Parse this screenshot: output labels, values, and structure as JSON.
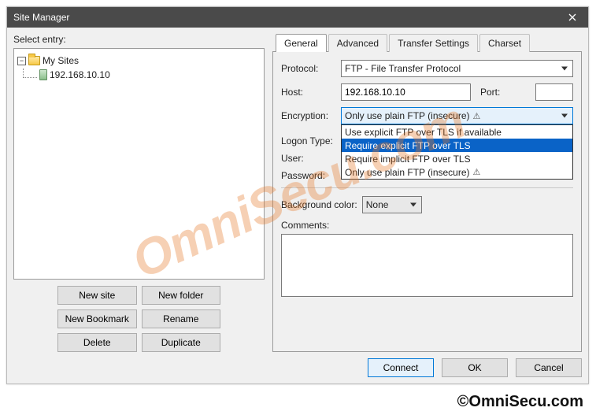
{
  "window": {
    "title": "Site Manager"
  },
  "leftPane": {
    "selectEntryLabel": "Select entry:",
    "tree": {
      "rootLabel": "My Sites",
      "siteLabel": "192.168.10.10"
    },
    "buttons": {
      "newSite": "New site",
      "newFolder": "New folder",
      "newBookmark": "New Bookmark",
      "rename": "Rename",
      "delete": "Delete",
      "duplicate": "Duplicate"
    }
  },
  "tabs": {
    "general": "General",
    "advanced": "Advanced",
    "transfer": "Transfer Settings",
    "charset": "Charset"
  },
  "general": {
    "protocolLabel": "Protocol:",
    "protocolValue": "FTP - File Transfer Protocol",
    "hostLabel": "Host:",
    "hostValue": "192.168.10.10",
    "portLabel": "Port:",
    "portValue": "",
    "encryptionLabel": "Encryption:",
    "encryptionValue": "Only use plain FTP (insecure)",
    "encryptionOptions": {
      "opt0": "Use explicit FTP over TLS if available",
      "opt1": "Require explicit FTP over TLS",
      "opt2": "Require implicit FTP over TLS",
      "opt3": "Only use plain FTP (insecure)"
    },
    "logonTypeLabel": "Logon Type:",
    "userLabel": "User:",
    "passwordLabel": "Password:",
    "bgColorLabel": "Background color:",
    "bgColorValue": "None",
    "commentsLabel": "Comments:"
  },
  "footer": {
    "connect": "Connect",
    "ok": "OK",
    "cancel": "Cancel"
  },
  "watermark": "OmniSecu.com",
  "copyright": "©OmniSecu.com"
}
